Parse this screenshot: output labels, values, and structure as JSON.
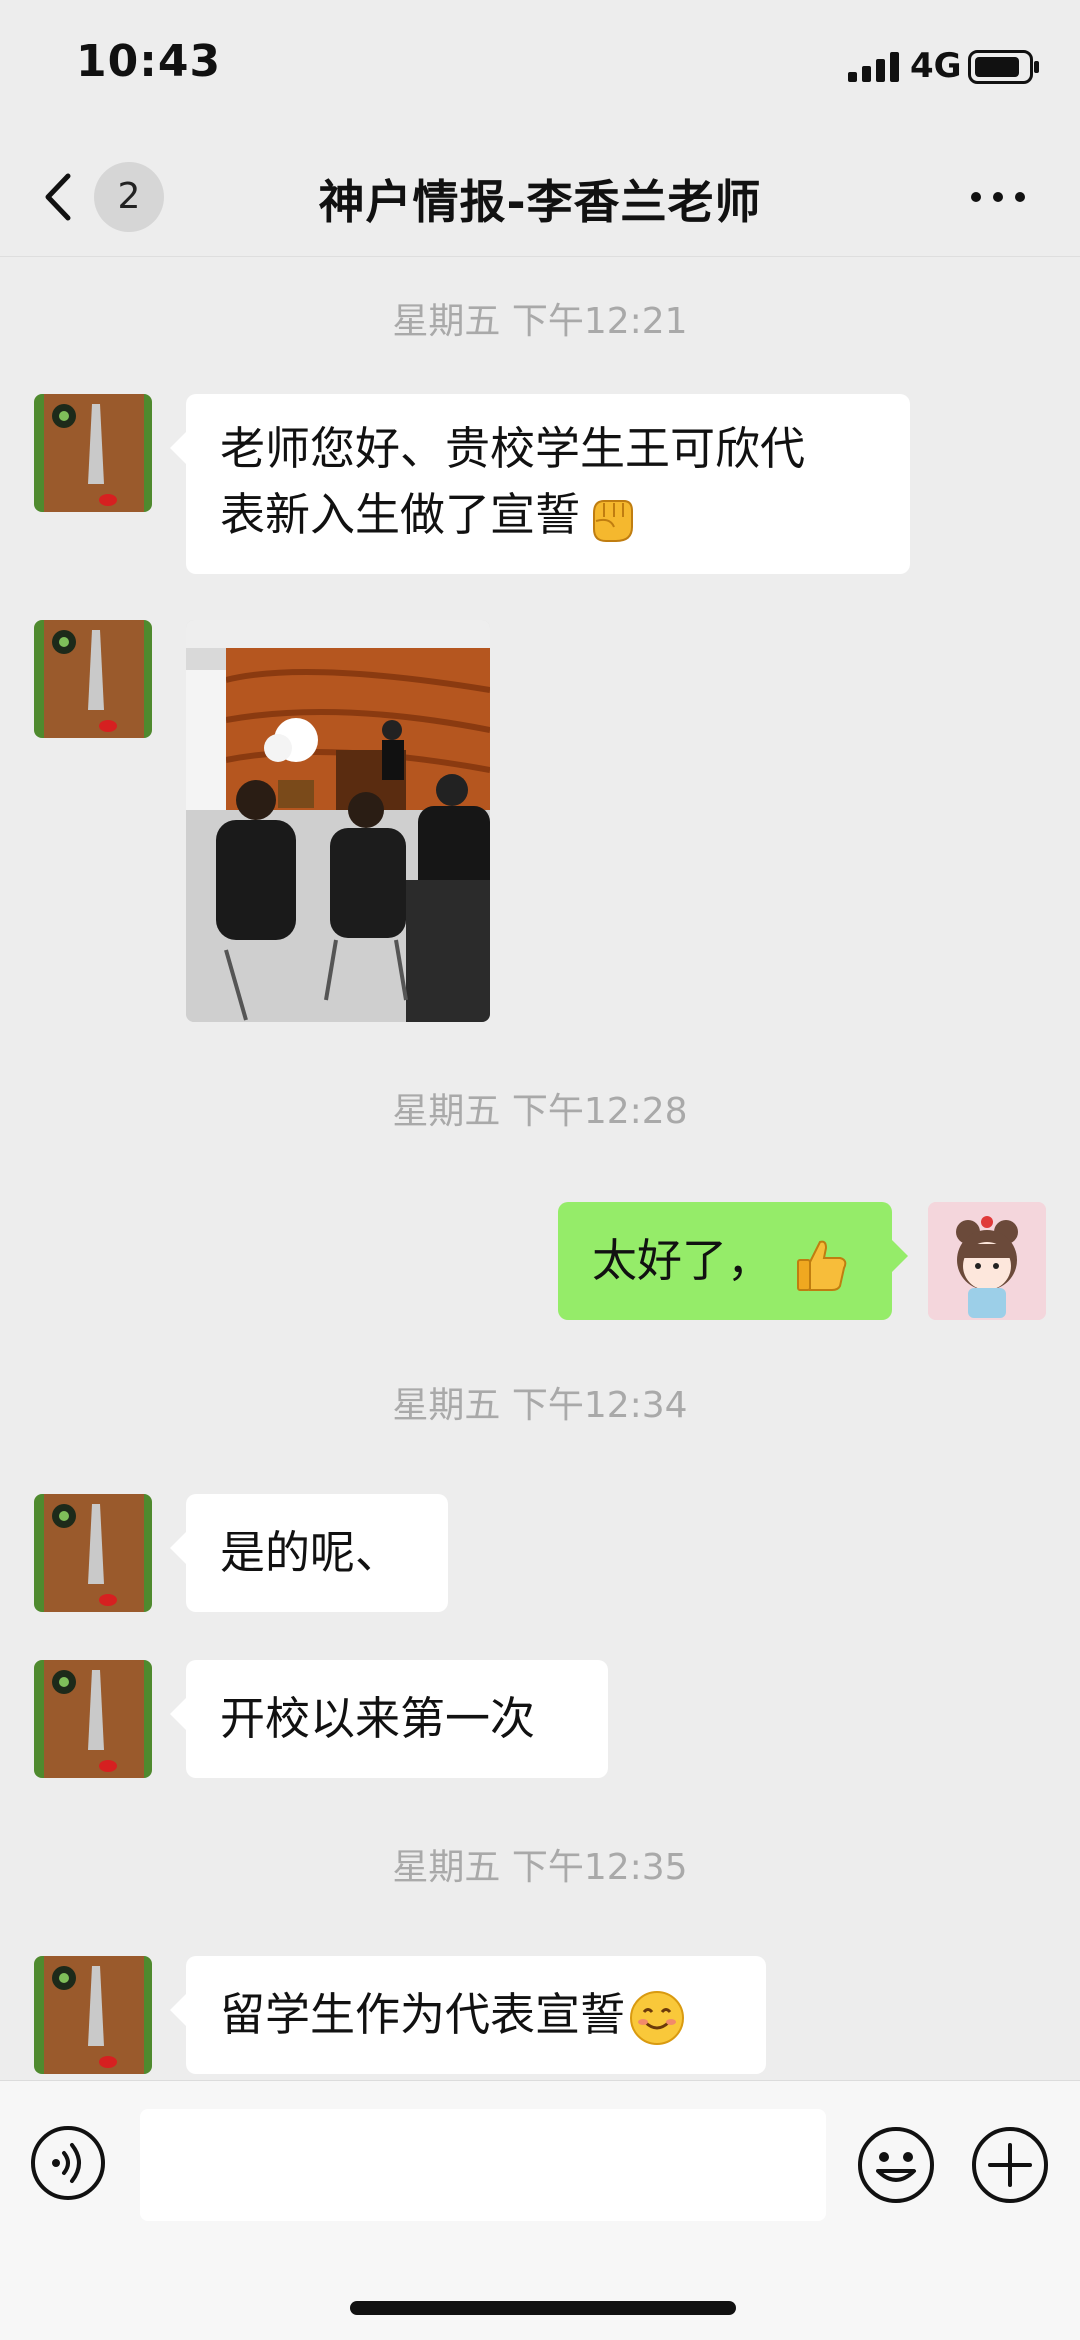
{
  "status": {
    "time": "10:43",
    "network": "4G",
    "signal_icon": "cellular-signal-icon",
    "battery_icon": "battery-icon"
  },
  "nav": {
    "unread_count": "2",
    "title": "神户情报-李香兰老师",
    "back_icon": "chevron-left-icon",
    "more_icon": "more-dots-icon"
  },
  "messages": [
    {
      "type": "time",
      "text": "星期五 下午12:21"
    },
    {
      "type": "text",
      "from": "other",
      "lines": [
        "老师您好、贵校学生王可欣代",
        "表新入生做了宣誓"
      ],
      "emoji": "raised-fist-emoji"
    },
    {
      "type": "image",
      "from": "other",
      "image_desc": "photo"
    },
    {
      "type": "time",
      "text": "星期五 下午12:28"
    },
    {
      "type": "text",
      "from": "me",
      "text": "太好了，",
      "emoji": "thumbs-up-emoji"
    },
    {
      "type": "time",
      "text": "星期五 下午12:34"
    },
    {
      "type": "text",
      "from": "other",
      "text": "是的呢、"
    },
    {
      "type": "text",
      "from": "other",
      "text": "开校以来第一次"
    },
    {
      "type": "time",
      "text": "星期五 下午12:35"
    },
    {
      "type": "text",
      "from": "other",
      "text": "留学生作为代表宣誓",
      "emoji": "smiling-face-emoji"
    }
  ],
  "input_bar": {
    "placeholder": "",
    "voice_icon": "voice-icon",
    "emoji_icon": "emoji-icon",
    "plus_icon": "plus-icon"
  },
  "colors": {
    "background": "#ededed",
    "my_bubble": "#95ec69",
    "other_bubble": "#ffffff",
    "timestamp": "#a9a9a9"
  }
}
